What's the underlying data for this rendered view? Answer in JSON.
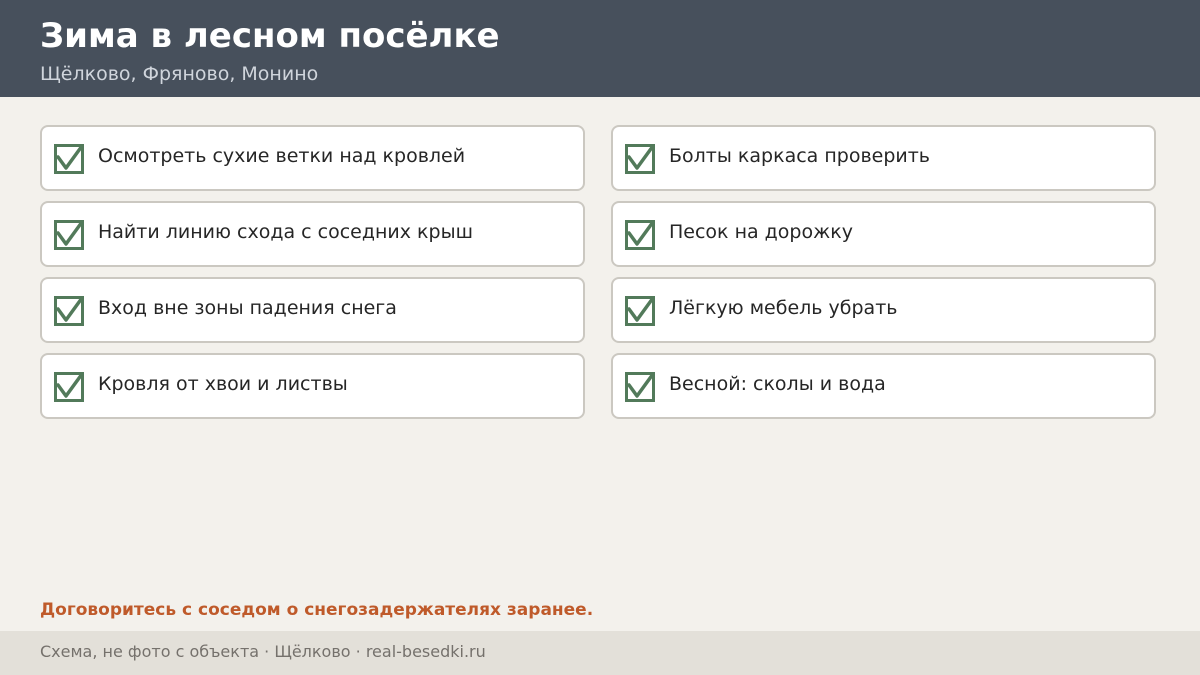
{
  "header": {
    "title": "Зима в лесном посёлке",
    "subtitle": "Щёлково, Фряново, Монино"
  },
  "checklist": [
    {
      "label": "Осмотреть сухие ветки над кровлей",
      "checked": true
    },
    {
      "label": "Болты каркаса проверить",
      "checked": true
    },
    {
      "label": "Найти линию схода с соседних крыш",
      "checked": true
    },
    {
      "label": "Песок на дорожку",
      "checked": true
    },
    {
      "label": "Вход вне зоны падения снега",
      "checked": true
    },
    {
      "label": "Лёгкую мебель убрать",
      "checked": true
    },
    {
      "label": "Кровля от хвои и листвы",
      "checked": true
    },
    {
      "label": "Весной: сколы и вода",
      "checked": true
    }
  ],
  "note": "Договоритесь с соседом о снегозадержателях заранее.",
  "footer": {
    "text": "Схема, не фото с объекта  ·  Щёлково  ·  real-besedki.ru"
  },
  "colors": {
    "header_bg": "#47505c",
    "page_bg": "#f3f1ec",
    "check_green": "#527a5a",
    "note_orange": "#bf5a2a",
    "footer_bg": "#e3e0d9"
  },
  "icons": {
    "check": "checkbox-checked-icon"
  }
}
